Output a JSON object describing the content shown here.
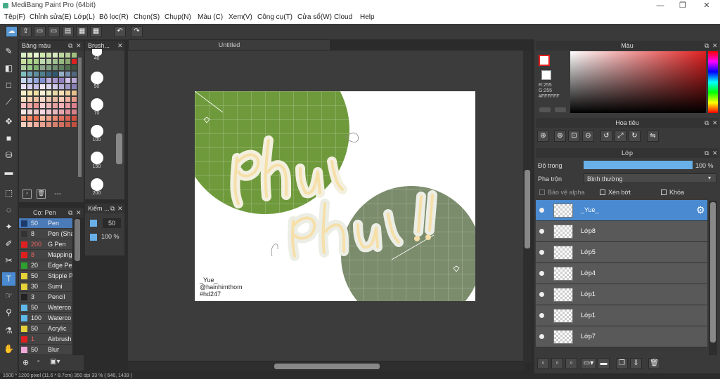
{
  "window": {
    "title": "MediBang Paint Pro (64bit)",
    "controls": [
      "—",
      "❐",
      "✕"
    ]
  },
  "menu": [
    "Tệp(F)",
    "Chỉnh sửa(E)",
    "Lớp(L)",
    "Bộ lọc(R)",
    "Chọn(S)",
    "Chụp(N)",
    "Màu (C)",
    "Xem(V)",
    "Công cụ(T)",
    "Cửa sổ(W)",
    "Cloud",
    "Help"
  ],
  "panels": {
    "palette_title": "Bảng màu",
    "palette_footer": "---",
    "brush_title": "Brush...",
    "brush_sizes": [
      "40",
      "50",
      "70",
      "100",
      "150",
      "200"
    ],
    "pen_title": "Cọ: Pen",
    "check_title": "Kiểm ...",
    "check_values": [
      "50",
      "100 %"
    ],
    "doc_tab": "Untitled",
    "color_title": "Màu",
    "color_readout": [
      "R:255",
      "G:255",
      "#FFFFFF"
    ],
    "nav_title": "Hoa tiêu",
    "layer_title": "Lớp",
    "opacity_label": "Độ trong",
    "opacity_value": "100 %",
    "opacity_fill": 1.0,
    "blend_label": "Pha trộn",
    "blend_value": "Bình thường",
    "checks": [
      "Bảo vệ alpha",
      "Xén bớt",
      "Khóa"
    ]
  },
  "pens": [
    {
      "size": "50",
      "name": "Pen",
      "color": "#1c3a6a",
      "selected": true
    },
    {
      "size": "8",
      "name": "Pen (Sha",
      "color": "#333333"
    },
    {
      "size": "200",
      "name": "G Pen",
      "color": "#e02020"
    },
    {
      "size": "8",
      "name": "Mapping",
      "color": "#e02020"
    },
    {
      "size": "20",
      "name": "Edge Pe",
      "color": "#2ea02e"
    },
    {
      "size": "50",
      "name": "Stipple P",
      "color": "#e6d23a"
    },
    {
      "size": "30",
      "name": "Sumi",
      "color": "#e6d23a"
    },
    {
      "size": "3",
      "name": "Pencil",
      "color": "#222222"
    },
    {
      "size": "50",
      "name": "Waterco",
      "color": "#5fb8e8"
    },
    {
      "size": "100",
      "name": "Waterco",
      "color": "#5fb8e8"
    },
    {
      "size": "50",
      "name": "Acrylic",
      "color": "#e6d23a"
    },
    {
      "size": "1",
      "name": "Airbrush",
      "color": "#e02020"
    },
    {
      "size": "50",
      "name": "Blur",
      "color": "#f0a8d8"
    }
  ],
  "layers": [
    {
      "name": "_Yue_",
      "selected": true
    },
    {
      "name": "Lớp8"
    },
    {
      "name": "Lớp5"
    },
    {
      "name": "Lớp4"
    },
    {
      "name": "Lớp1"
    },
    {
      "name": "Lớp1"
    },
    {
      "name": "Lớp7"
    }
  ],
  "canvas": {
    "text_lines": [
      "_Yue_",
      "@hainhimthom",
      "#hd247"
    ],
    "colors": {
      "green_dark": "#6f9a3c",
      "green_grey": "#7b8c6c",
      "white": "#ffffff"
    }
  },
  "status": "1600 * 1200 pixel   (11.6 * 8.7cm)   350 dpi   33 %   ( 646, 1439 )"
}
